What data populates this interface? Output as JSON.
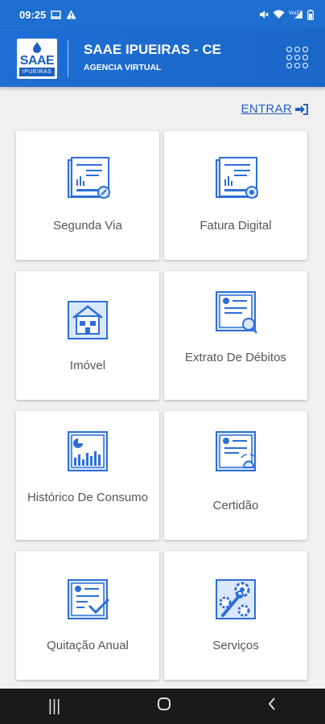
{
  "status_bar": {
    "time": "09:25",
    "icons": [
      "screen-cast-icon",
      "warning-icon",
      "mute-icon",
      "wifi-icon",
      "lte-signal-icon",
      "battery-icon"
    ]
  },
  "header": {
    "logo_text": "SAAE",
    "logo_subtext": "IPUEIRAS",
    "title": "SAAE IPUEIRAS - CE",
    "subtitle": "AGENCIA VIRTUAL",
    "menu_icon": "apps-grid-icon"
  },
  "login": {
    "label": "ENTRAR",
    "icon": "login-arrow-icon"
  },
  "menu": {
    "items": [
      {
        "label": "Segunda Via",
        "icon": "document-copy-icon"
      },
      {
        "label": "Fatura Digital",
        "icon": "digital-invoice-icon"
      },
      {
        "label": "Imóvel",
        "icon": "house-icon"
      },
      {
        "label": "Extrato De Débitos",
        "icon": "debt-statement-icon"
      },
      {
        "label": "Histórico De Consumo",
        "icon": "consumption-chart-icon"
      },
      {
        "label": "Certidão",
        "icon": "certificate-icon"
      },
      {
        "label": "Quitação Anual",
        "icon": "annual-discharge-icon"
      },
      {
        "label": "Serviços",
        "icon": "services-gears-icon"
      }
    ]
  },
  "colors": {
    "primary": "#1e6fd0",
    "icon_blue": "#2c6fd8",
    "icon_fill": "#dbe8fb",
    "card_text": "#555555",
    "background": "#f0f0f0"
  },
  "nav_bar": {
    "icons": [
      "recent-apps-icon",
      "home-icon",
      "back-icon"
    ]
  }
}
